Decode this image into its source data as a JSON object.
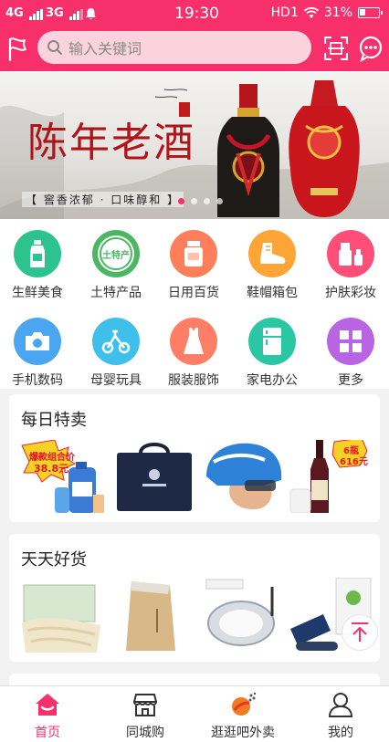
{
  "status_bar": {
    "sim1": "4G",
    "sim2": "3G",
    "time": "19:30",
    "hd": "HD1",
    "battery": "31%",
    "battery_level": 0.31
  },
  "header": {
    "search_placeholder": "输入关键词"
  },
  "banner": {
    "title": "陈年老酒",
    "slogan": "【 窖香浓郁 · 口味醇和 】",
    "slide_count": 4,
    "active_slide": 0
  },
  "categories": [
    {
      "label": "生鲜美食",
      "color": "#2cc38f",
      "icon": "bottle-icon"
    },
    {
      "label": "土特产品",
      "color": "#4bb763",
      "icon": "local-specialty-icon",
      "icon_text": "土特产"
    },
    {
      "label": "日用百货",
      "color": "#ff7f5b",
      "icon": "jar-icon"
    },
    {
      "label": "鞋帽箱包",
      "color": "#ffa436",
      "icon": "shoe-icon"
    },
    {
      "label": "护肤彩妆",
      "color": "#ff4e77",
      "icon": "cosmetics-icon"
    },
    {
      "label": "手机数码",
      "color": "#4aa6f0",
      "icon": "camera-icon"
    },
    {
      "label": "母婴玩具",
      "color": "#3ec0ea",
      "icon": "tricycle-icon"
    },
    {
      "label": "服装服饰",
      "color": "#ff7f66",
      "icon": "dress-icon"
    },
    {
      "label": "家电办公",
      "color": "#2bc6a3",
      "icon": "fridge-icon"
    },
    {
      "label": "更多",
      "color": "#b864e3",
      "icon": "grid-more-icon"
    }
  ],
  "daily_special": {
    "title": "每日特卖",
    "promo_badge_1": "爆款组合价",
    "promo_price_1": "38.8元",
    "promo_badge_2": "6瓶",
    "promo_price_2": "616元"
  },
  "daily_goods": {
    "title": "天天好货"
  },
  "tabbar": [
    {
      "label": "首页",
      "icon": "home-icon",
      "active": true
    },
    {
      "label": "同城购",
      "icon": "store-icon",
      "active": false
    },
    {
      "label": "逛逛吧外卖",
      "icon": "takeout-icon",
      "active": false
    },
    {
      "label": "我的",
      "icon": "user-icon",
      "active": false
    }
  ]
}
